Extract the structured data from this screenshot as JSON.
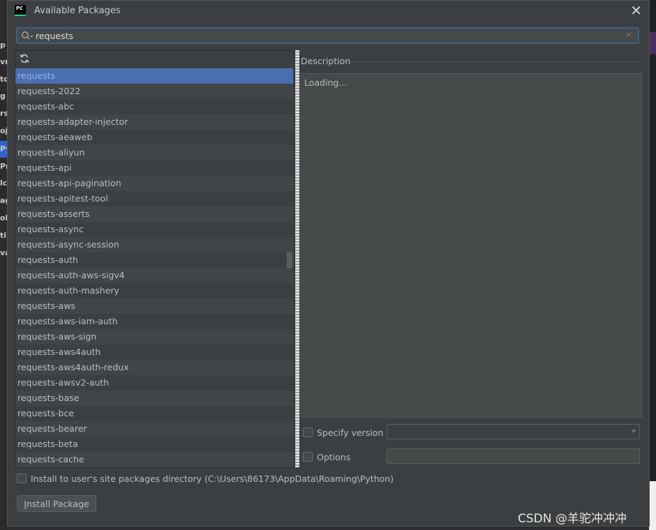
{
  "window": {
    "title": "Available Packages",
    "app_icon_text": "PC"
  },
  "search": {
    "value": "requests"
  },
  "packages": [
    "requests",
    "requests-2022",
    "requests-abc",
    "requests-adapter-injector",
    "requests-aeaweb",
    "requests-aliyun",
    "requests-api",
    "requests-api-pagination",
    "requests-apitest-tool",
    "requests-asserts",
    "requests-async",
    "requests-async-session",
    "requests-auth",
    "requests-auth-aws-sigv4",
    "requests-auth-mashery",
    "requests-aws",
    "requests-aws-iam-auth",
    "requests-aws-sign",
    "requests-aws4auth",
    "requests-aws4auth-redux",
    "requests-awsv2-auth",
    "requests-base",
    "requests-bce",
    "requests-bearer",
    "requests-beta",
    "requests-cache"
  ],
  "selected_index": 0,
  "description": {
    "label": "Description",
    "text": "Loading..."
  },
  "specify_version": {
    "label": "Specify version",
    "checked": false
  },
  "options": {
    "label": "Options",
    "checked": false,
    "value": ""
  },
  "install_user_site": {
    "label": "Install to user's site packages directory (C:\\Users\\86173\\AppData\\Roaming\\Python)",
    "checked": false
  },
  "install_button": {
    "mnemonic": "I",
    "rest": "nstall Package"
  },
  "watermark": "CSDN @羊驼冲冲冲",
  "background_left_letters": [
    "p",
    "vr",
    "to",
    "g",
    "rs",
    "oj",
    "Py",
    "Pr",
    "lc",
    "ag",
    "ol",
    "ti",
    "va"
  ],
  "colors": {
    "dialog_bg": "#3c3f41",
    "selection": "#4b6eaf",
    "focus_border": "#3d6185"
  }
}
